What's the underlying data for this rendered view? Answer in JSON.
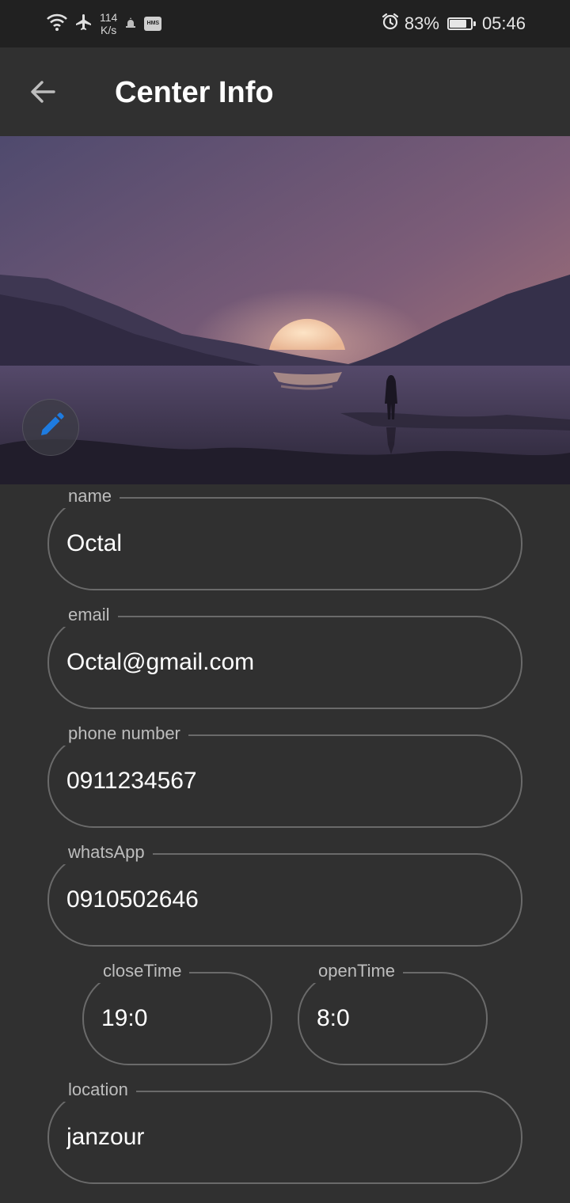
{
  "status_bar": {
    "speed_value": "114",
    "speed_unit": "K/s",
    "hms_badge": "HMS",
    "battery_percent": "83%",
    "battery_level": 0.83,
    "time": "05:46",
    "icons": [
      "wifi-icon",
      "airplane-icon",
      "mosque-icon",
      "hms-icon",
      "alarm-icon",
      "battery-icon"
    ]
  },
  "app_bar": {
    "title": "Center Info",
    "back_icon": "arrow-left-icon"
  },
  "banner": {
    "edit_icon": "pencil-icon"
  },
  "form": {
    "name": {
      "label": "name",
      "value": "Octal"
    },
    "email": {
      "label": "email",
      "value": "Octal@gmail.com"
    },
    "phone": {
      "label": "phone number",
      "value": "0911234567"
    },
    "whatsapp": {
      "label": "whatsApp",
      "value": "0910502646"
    },
    "close_time": {
      "label": "closeTime",
      "value": "19:0"
    },
    "open_time": {
      "label": "openTime",
      "value": "8:0"
    },
    "location": {
      "label": "location",
      "value": "janzour"
    }
  },
  "colors": {
    "background": "#303030",
    "status_bar": "#212121",
    "field_border": "#6a6a6a",
    "label": "#bdbdbd",
    "accent_edit": "#1e7be0"
  }
}
